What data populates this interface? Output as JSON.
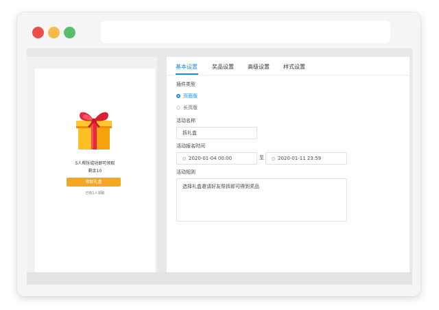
{
  "preview": {
    "gift_title": "5人帮拆成功即可领取",
    "remaining": "剩余10",
    "claim_button": "领取礼盒",
    "claimed_count": "已有1人领取"
  },
  "tabs": [
    {
      "label": "基本设置",
      "active": true
    },
    {
      "label": "奖品设置",
      "active": false
    },
    {
      "label": "高级设置",
      "active": false
    },
    {
      "label": "样式设置",
      "active": false
    }
  ],
  "form": {
    "plugin_type_label": "插件类型",
    "plugin_type_options": [
      {
        "label": "页面版",
        "checked": true
      },
      {
        "label": "长页版",
        "checked": false
      }
    ],
    "activity_name_label": "活动名称",
    "activity_name_value": "拆礼盒",
    "signup_time_label": "活动报名时间",
    "start_time": "2020-01-04 00:00",
    "range_separator": "至",
    "end_time": "2020-01-11 23:59",
    "rules_label": "活动规则",
    "rules_value": "选择礼盒邀请好友帮拆即可得到奖品"
  },
  "colors": {
    "accent": "#1e88e5",
    "claim_button": "#f5a623",
    "window_close": "#ee4b4d",
    "window_minimize": "#f5b94d",
    "window_maximize": "#57bf6a"
  }
}
